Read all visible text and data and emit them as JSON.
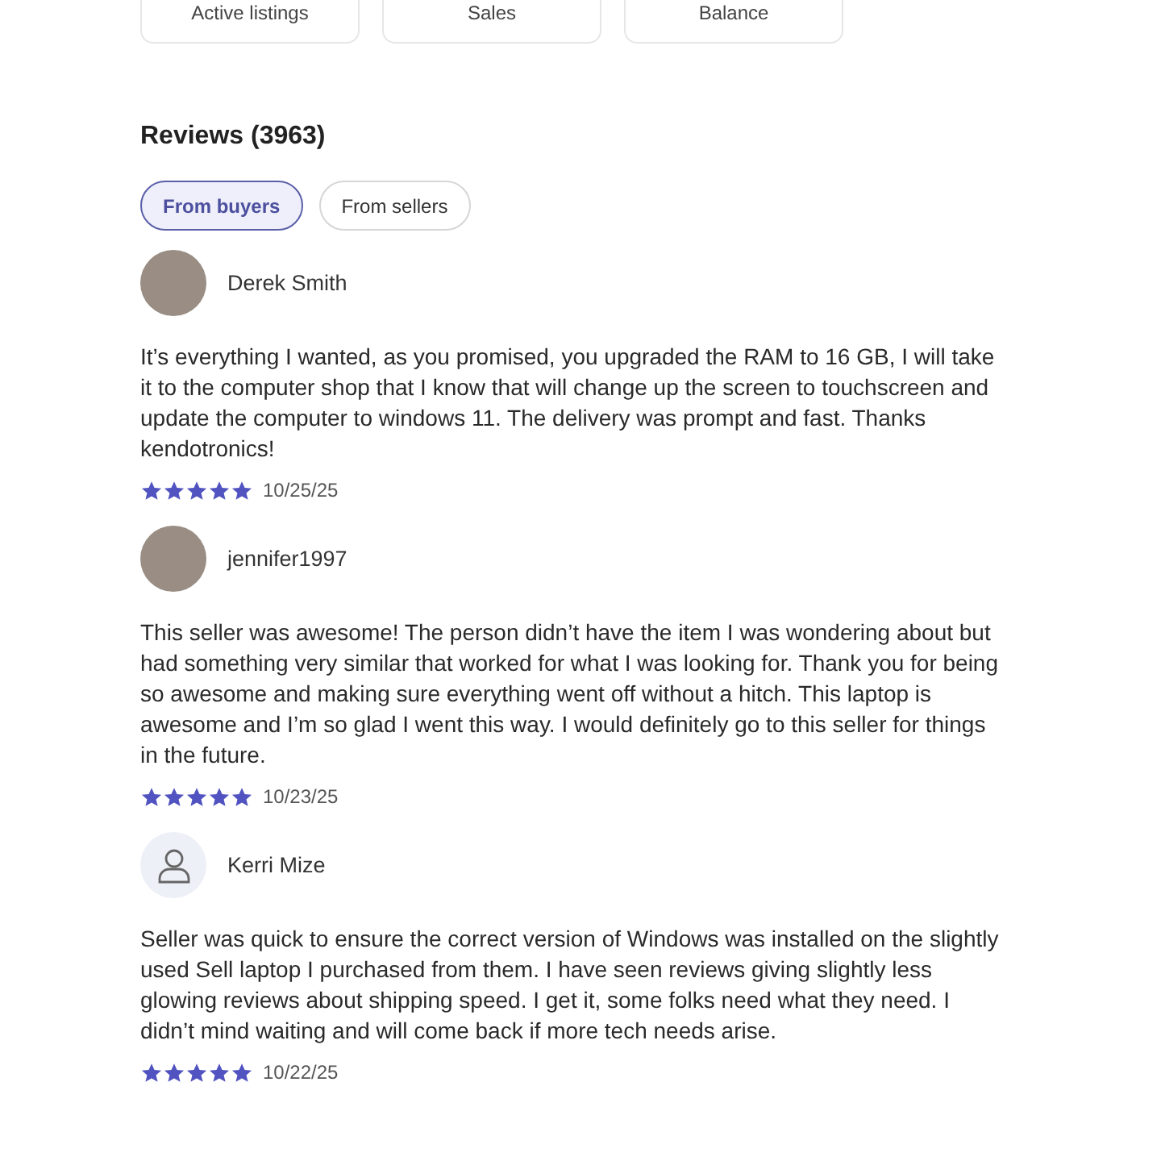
{
  "stats": [
    {
      "label": "Active listings"
    },
    {
      "label": "Sales"
    },
    {
      "label": "Balance"
    }
  ],
  "reviews_title": "Reviews (3963)",
  "filters": [
    {
      "label": "From buyers",
      "selected": true
    },
    {
      "label": "From sellers",
      "selected": false
    }
  ],
  "reviews": [
    {
      "author": "Derek Smith",
      "kind": "photo",
      "text": "It’s everything I wanted, as you promised, you upgraded the RAM to 16 GB, I will take it to the computer shop that I know that will change up the screen to touchscreen and update the computer to windows 11. The delivery was prompt and fast. Thanks kendotronics!",
      "stars": 5,
      "date": "10/25/25"
    },
    {
      "author": "jennifer1997",
      "kind": "photo",
      "text": "This seller was awesome! The person didn’t have the item I was wondering about but had something very similar that worked for what I was looking for. Thank you for being so awesome and making sure everything went off without a hitch. This laptop is awesome and I’m so glad I went this way. I would definitely go to this seller for things in the future.",
      "stars": 5,
      "date": "10/23/25"
    },
    {
      "author": "Kerri Mize",
      "kind": "default",
      "text": "Seller was quick to ensure the correct version of Windows was installed on the slightly used Sell laptop I purchased from them. I have seen reviews giving slightly less glowing reviews about shipping speed. I get it, some folks need what they need. I didn’t mind waiting and will come back if more tech needs arise.",
      "stars": 5,
      "date": "10/22/25"
    }
  ]
}
